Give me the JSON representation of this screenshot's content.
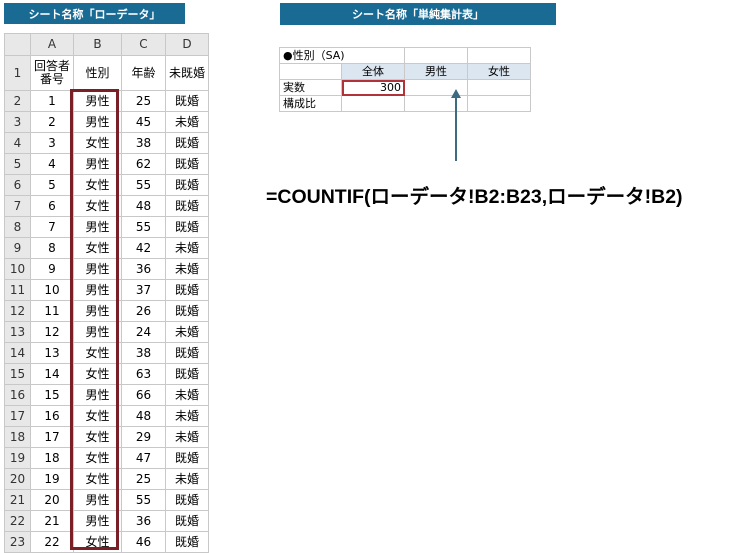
{
  "banners": {
    "raw_sheet": "シート名称「ローデータ」",
    "summary_sheet": "シート名称「単純集計表」"
  },
  "raw_sheet": {
    "column_letters": [
      "A",
      "B",
      "C",
      "D"
    ],
    "header_row_number": "1",
    "headers": [
      "回答者\n番号",
      "性別",
      "年齢",
      "未既婚"
    ],
    "rows": [
      {
        "row": "2",
        "id": "1",
        "gender": "男性",
        "age": "25",
        "marital": "既婚"
      },
      {
        "row": "3",
        "id": "2",
        "gender": "男性",
        "age": "45",
        "marital": "未婚"
      },
      {
        "row": "4",
        "id": "3",
        "gender": "女性",
        "age": "38",
        "marital": "既婚"
      },
      {
        "row": "5",
        "id": "4",
        "gender": "男性",
        "age": "62",
        "marital": "既婚"
      },
      {
        "row": "6",
        "id": "5",
        "gender": "女性",
        "age": "55",
        "marital": "既婚"
      },
      {
        "row": "7",
        "id": "6",
        "gender": "女性",
        "age": "48",
        "marital": "既婚"
      },
      {
        "row": "8",
        "id": "7",
        "gender": "男性",
        "age": "55",
        "marital": "既婚"
      },
      {
        "row": "9",
        "id": "8",
        "gender": "女性",
        "age": "42",
        "marital": "未婚"
      },
      {
        "row": "10",
        "id": "9",
        "gender": "男性",
        "age": "36",
        "marital": "未婚"
      },
      {
        "row": "11",
        "id": "10",
        "gender": "男性",
        "age": "37",
        "marital": "既婚"
      },
      {
        "row": "12",
        "id": "11",
        "gender": "男性",
        "age": "26",
        "marital": "既婚"
      },
      {
        "row": "13",
        "id": "12",
        "gender": "男性",
        "age": "24",
        "marital": "未婚"
      },
      {
        "row": "14",
        "id": "13",
        "gender": "女性",
        "age": "38",
        "marital": "既婚"
      },
      {
        "row": "15",
        "id": "14",
        "gender": "女性",
        "age": "63",
        "marital": "既婚"
      },
      {
        "row": "16",
        "id": "15",
        "gender": "男性",
        "age": "66",
        "marital": "未婚"
      },
      {
        "row": "17",
        "id": "16",
        "gender": "女性",
        "age": "48",
        "marital": "未婚"
      },
      {
        "row": "18",
        "id": "17",
        "gender": "女性",
        "age": "29",
        "marital": "未婚"
      },
      {
        "row": "19",
        "id": "18",
        "gender": "女性",
        "age": "47",
        "marital": "既婚"
      },
      {
        "row": "20",
        "id": "19",
        "gender": "女性",
        "age": "25",
        "marital": "未婚"
      },
      {
        "row": "21",
        "id": "20",
        "gender": "男性",
        "age": "55",
        "marital": "既婚"
      },
      {
        "row": "22",
        "id": "21",
        "gender": "男性",
        "age": "36",
        "marital": "既婚"
      },
      {
        "row": "23",
        "id": "22",
        "gender": "女性",
        "age": "46",
        "marital": "既婚"
      }
    ]
  },
  "summary_sheet": {
    "question_label": "●性別（SA)",
    "columns": [
      "全体",
      "男性",
      "女性"
    ],
    "rows": [
      {
        "label": "実数",
        "values": [
          "300",
          "",
          ""
        ]
      },
      {
        "label": "構成比",
        "values": [
          "",
          "",
          ""
        ]
      }
    ]
  },
  "formula": "=COUNTIF(ローデータ!B2:B23,ローデータ!B2)",
  "colors": {
    "banner": "#1a6b94",
    "highlight": "#7a1f25",
    "selected_cell": "#b2323a",
    "arrow": "#3d6b80",
    "summary_header": "#dce6f1"
  }
}
